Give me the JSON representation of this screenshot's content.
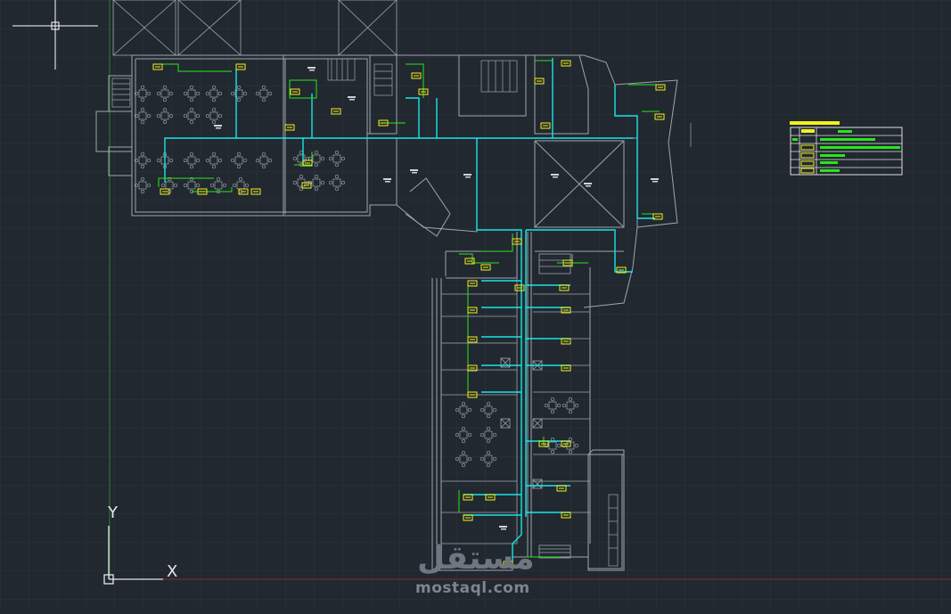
{
  "app": {
    "kind": "cad-drawing-viewport"
  },
  "ucs": {
    "x_label": "X",
    "y_label": "Y"
  },
  "watermark": {
    "logo_text": "مستقل",
    "site_text": "mostaql.com"
  },
  "colors": {
    "background": "#212830",
    "grid": "#2c343d",
    "walls": "#9ea6ad",
    "duct_main": "#19e6e6",
    "units": "#f2f21a",
    "green": "#29e61a",
    "x_axis": "#8a2a2a",
    "y_axis": "#2e7d2e"
  }
}
